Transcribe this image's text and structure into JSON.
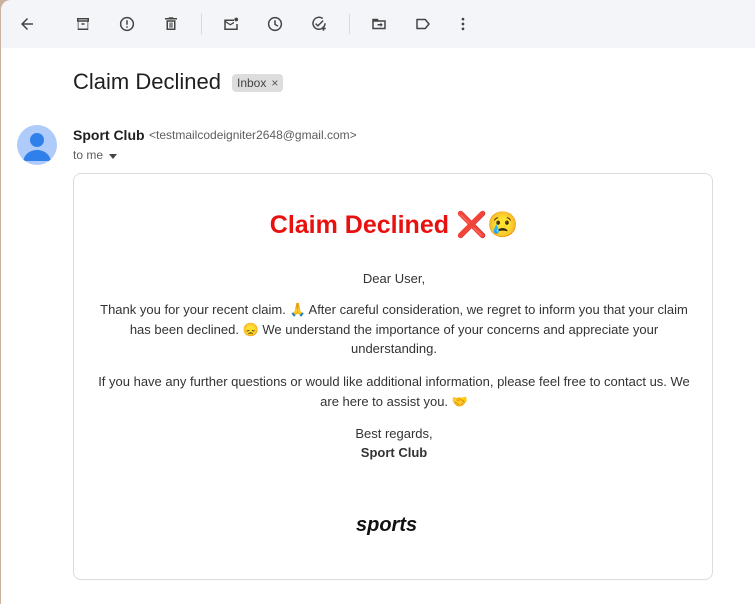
{
  "toolbar": {
    "buttons": [
      "back-icon",
      "archive-icon",
      "report-spam-icon",
      "delete-icon",
      "mark-unread-icon",
      "snooze-icon",
      "add-task-icon",
      "move-to-icon",
      "label-icon",
      "more-vert-icon"
    ]
  },
  "email": {
    "subject": "Claim Declined",
    "label": "Inbox",
    "label_remove": "×",
    "sender_name": "Sport Club",
    "sender_email": "<testmailcodeigniter2648@gmail.com>",
    "to": "to me"
  },
  "message": {
    "heading": "Claim Declined ❌😢",
    "greeting": "Dear User,",
    "para1": "Thank you for your recent claim. 🙏 After careful consideration, we regret to inform you that your claim has been declined. 😞 We understand the importance of your concerns and appreciate your understanding.",
    "para2": "If you have any further questions or would like additional information, please feel free to contact us. We are here to assist you. 🤝",
    "closing": "Best regards,",
    "signature": "Sport Club",
    "logo_text": "sports"
  },
  "colors": {
    "heading": "#e8110f",
    "toolbar_bg": "#f3f5f8"
  }
}
